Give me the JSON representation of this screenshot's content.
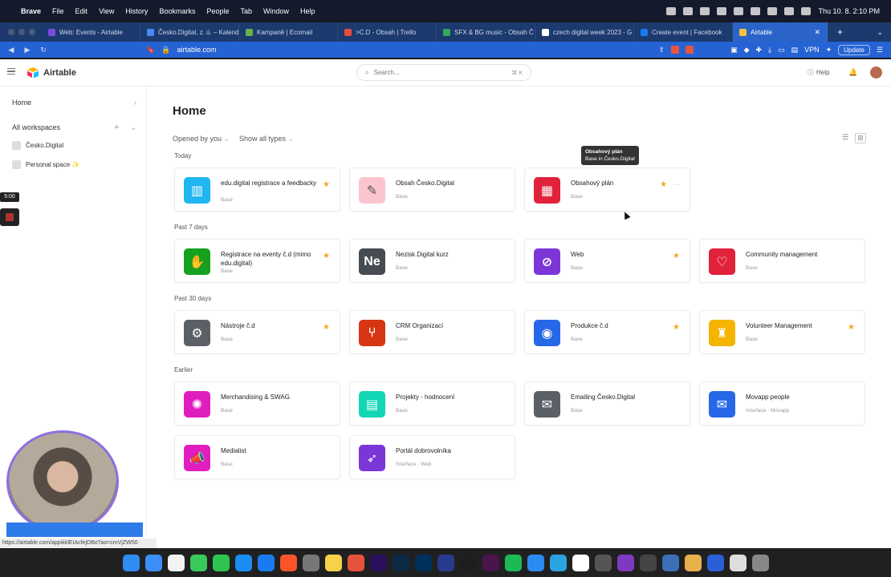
{
  "menubar": {
    "items": [
      "Brave",
      "File",
      "Edit",
      "View",
      "History",
      "Bookmarks",
      "People",
      "Tab",
      "Window",
      "Help"
    ],
    "clock": "Thu 10. 8.  2:10 PM"
  },
  "tabs": [
    {
      "label": "Web: Events - Airtable",
      "color": "#7c4ddb"
    },
    {
      "label": "Česko.Digital, z. ú. – Kalend",
      "color": "#4a8af4"
    },
    {
      "label": "Kampaně | Ecomail",
      "color": "#6ab04c"
    },
    {
      "label": ">C.D - Obsah | Trello",
      "color": "#e74c3c"
    },
    {
      "label": "SFX & BG music - Obsah Č",
      "color": "#34a853"
    },
    {
      "label": "czech digital week 2023 - G",
      "color": "#ffffff"
    },
    {
      "label": "Create event | Facebook",
      "color": "#1877f2"
    },
    {
      "label": "Airtable",
      "color": "#f9c33d",
      "active": true
    }
  ],
  "address": {
    "url": "airtable.com",
    "vpn": "VPN",
    "update": "Update"
  },
  "app": {
    "brand": "Airtable",
    "search_placeholder": "Search...",
    "search_shortcut": "⌘ K",
    "help": "Help"
  },
  "sidebar": {
    "home": "Home",
    "all_workspaces": "All workspaces",
    "workspaces": [
      "Česko.Digital",
      "Personal space ✨"
    ]
  },
  "main": {
    "title": "Home",
    "filter_opened": "Opened by you",
    "filter_types": "Show all types",
    "tooltip_line1": "Obsahový plán",
    "tooltip_line2": "Base in Česko.Digital"
  },
  "sections": [
    {
      "label": "Today",
      "cards": [
        {
          "name": "edu.digital registrace a feedbacky",
          "sub": "Base",
          "icon": "book-icon",
          "color": "#20b6f2",
          "starred": true
        },
        {
          "name": "Obsah Česko.Digital",
          "sub": "Base",
          "icon": "pen-icon",
          "color": "#fbc5cf",
          "starred": false
        },
        {
          "name": "Obsahový plán",
          "sub": "Base",
          "icon": "calendar-icon",
          "color": "#e0223a",
          "starred": true,
          "more": true
        }
      ]
    },
    {
      "label": "Past 7 days",
      "cards": [
        {
          "name": "Registrace na eventy č.d (mimo edu.digital)",
          "sub": "Base",
          "icon": "hand-icon",
          "color": "#15a01f",
          "starred": true
        },
        {
          "name": "Nezisk.Digital kurz",
          "sub": "Base",
          "icon": "text-icon",
          "text": "Ne",
          "color": "#474b52",
          "starred": false
        },
        {
          "name": "Web",
          "sub": "Base",
          "icon": "compass-icon",
          "color": "#7c36d8",
          "starred": true
        },
        {
          "name": "Community management",
          "sub": "Base",
          "icon": "heart-icon",
          "color": "#e0223a",
          "starred": false
        }
      ]
    },
    {
      "label": "Past 30 days",
      "cards": [
        {
          "name": "Nástroje č.d",
          "sub": "Base",
          "icon": "gears-icon",
          "color": "#5b5f66",
          "starred": true
        },
        {
          "name": "CRM Organizací",
          "sub": "Base",
          "icon": "branch-icon",
          "color": "#d73514",
          "starred": false
        },
        {
          "name": "Produkce č.d",
          "sub": "Base",
          "icon": "camera-icon",
          "color": "#2768e8",
          "starred": true
        },
        {
          "name": "Volunteer Management",
          "sub": "Base",
          "icon": "boot-icon",
          "color": "#f5b400",
          "starred": true
        }
      ]
    },
    {
      "label": "Earlier",
      "cards": [
        {
          "name": "Merchandising & SWAG",
          "sub": "Base",
          "icon": "badge-icon",
          "color": "#e01ec0",
          "starred": false
        },
        {
          "name": "Projekty - hodnocení",
          "sub": "Base",
          "icon": "building-icon",
          "color": "#12d6b5",
          "starred": false
        },
        {
          "name": "Emailing Česko.Digital",
          "sub": "Base",
          "icon": "mail-icon",
          "color": "#5b5f66",
          "starred": false
        },
        {
          "name": "Movapp people",
          "sub": "Interface · Movapp",
          "icon": "mail-icon",
          "color": "#2768e8",
          "starred": false
        }
      ]
    },
    {
      "label": "",
      "cards": [
        {
          "name": "Medialist",
          "sub": "Base",
          "icon": "megaphone-icon",
          "color": "#e01ec0",
          "starred": false
        },
        {
          "name": "Portál dobrovolníka",
          "sub": "Interface · Web",
          "icon": "rocket-icon",
          "color": "#7c36d8",
          "starred": false
        }
      ]
    }
  ],
  "overlay": {
    "timer": "5:00",
    "status_url": "https://airtable.com/appikklEIAcfejDBo?ao=cmVjZW50"
  }
}
